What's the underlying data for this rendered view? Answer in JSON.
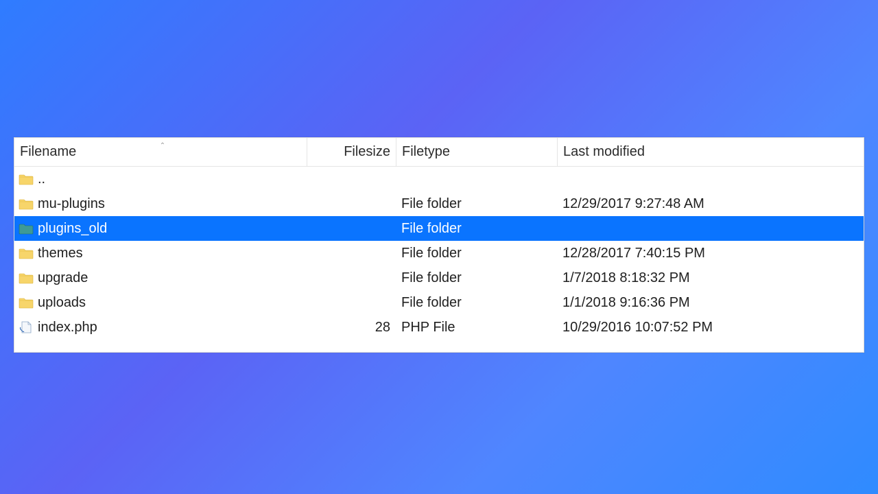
{
  "columns": {
    "filename": "Filename",
    "filesize": "Filesize",
    "filetype": "Filetype",
    "last_modified": "Last modified"
  },
  "sort": {
    "column": "filename",
    "direction": "asc"
  },
  "rows": [
    {
      "icon": "folder",
      "name": "..",
      "size": "",
      "type": "",
      "modified": "",
      "selected": false
    },
    {
      "icon": "folder",
      "name": "mu-plugins",
      "size": "",
      "type": "File folder",
      "modified": "12/29/2017 9:27:48 AM",
      "selected": false
    },
    {
      "icon": "folder-sel",
      "name": "plugins_old",
      "size": "",
      "type": "File folder",
      "modified": "",
      "selected": true
    },
    {
      "icon": "folder",
      "name": "themes",
      "size": "",
      "type": "File folder",
      "modified": "12/28/2017 7:40:15 PM",
      "selected": false
    },
    {
      "icon": "folder",
      "name": "upgrade",
      "size": "",
      "type": "File folder",
      "modified": "1/7/2018 8:18:32 PM",
      "selected": false
    },
    {
      "icon": "folder",
      "name": "uploads",
      "size": "",
      "type": "File folder",
      "modified": "1/1/2018 9:16:36 PM",
      "selected": false
    },
    {
      "icon": "file",
      "name": "index.php",
      "size": "28",
      "type": "PHP File",
      "modified": "10/29/2016 10:07:52 PM",
      "selected": false
    }
  ]
}
